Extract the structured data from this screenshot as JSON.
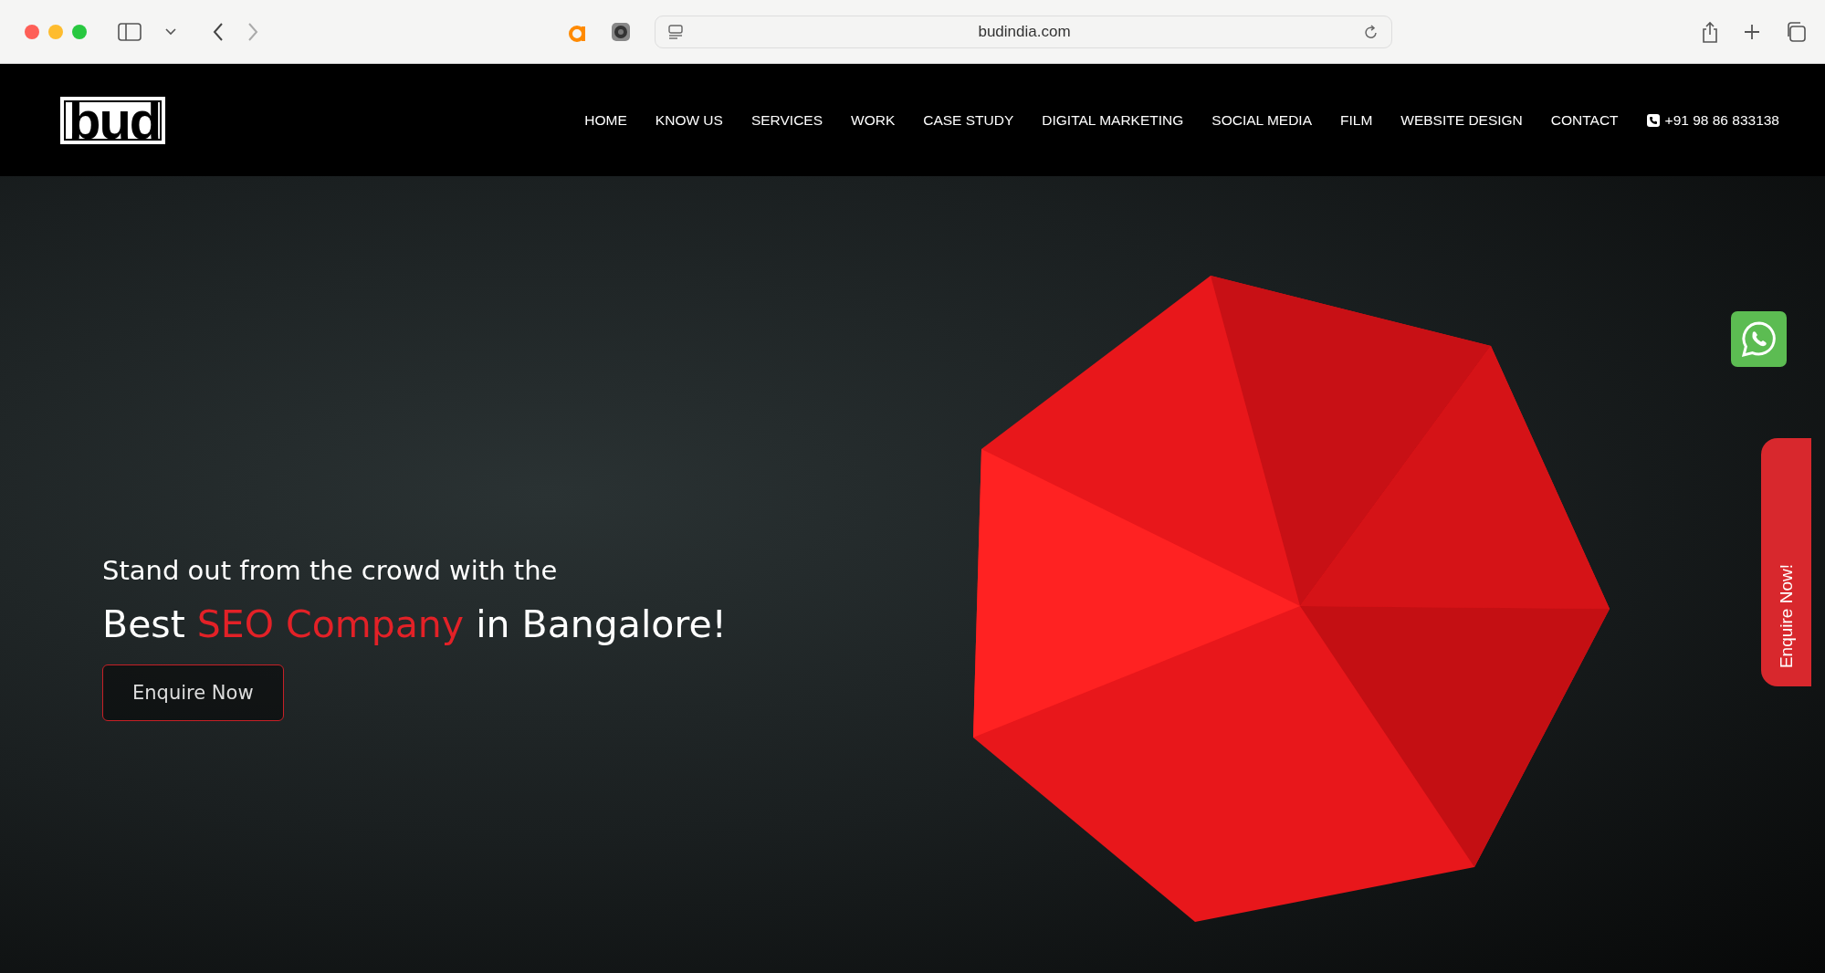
{
  "browser": {
    "url": "budindia.com"
  },
  "header": {
    "logo": "bud",
    "nav": [
      {
        "label": "HOME"
      },
      {
        "label": "KNOW US"
      },
      {
        "label": "SERVICES"
      },
      {
        "label": "WORK"
      },
      {
        "label": "CASE STUDY"
      },
      {
        "label": "DIGITAL MARKETING"
      },
      {
        "label": "SOCIAL MEDIA"
      },
      {
        "label": "FILM"
      },
      {
        "label": "WEBSITE DESIGN"
      },
      {
        "label": "CONTACT"
      }
    ],
    "phone": "+91 98 86 833138"
  },
  "hero": {
    "tagline": "Stand out from the crowd with the",
    "headline": [
      {
        "text": "Best ",
        "highlight": false
      },
      {
        "text": "SEO Company",
        "highlight": true
      },
      {
        "text": " in Bangalore!",
        "highlight": false
      }
    ],
    "button": "Enquire Now"
  },
  "side_tab": {
    "label": "Enquire Now!"
  }
}
